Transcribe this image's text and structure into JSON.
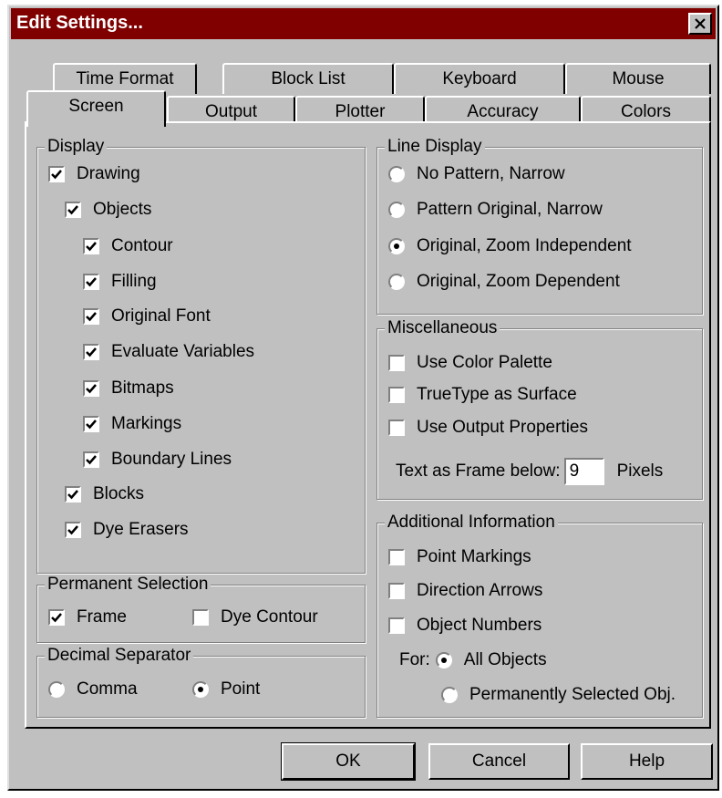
{
  "window": {
    "title": "Edit Settings..."
  },
  "tabs_back": [
    {
      "label": "Time Format"
    },
    {
      "label": "Block List"
    },
    {
      "label": "Keyboard"
    },
    {
      "label": "Mouse"
    }
  ],
  "tabs_front": [
    {
      "label": "Screen",
      "active": true
    },
    {
      "label": "Output"
    },
    {
      "label": "Plotter"
    },
    {
      "label": "Accuracy"
    },
    {
      "label": "Colors"
    }
  ],
  "display": {
    "legend": "Display",
    "items": [
      {
        "label": "Drawing",
        "checked": true
      },
      {
        "label": "Objects",
        "checked": true
      },
      {
        "label": "Contour",
        "checked": true
      },
      {
        "label": "Filling",
        "checked": true
      },
      {
        "label": "Original Font",
        "checked": true
      },
      {
        "label": "Evaluate Variables",
        "checked": true
      },
      {
        "label": "Bitmaps",
        "checked": true
      },
      {
        "label": "Markings",
        "checked": true
      },
      {
        "label": "Boundary Lines",
        "checked": true
      },
      {
        "label": "Blocks",
        "checked": true
      },
      {
        "label": "Dye Erasers",
        "checked": true
      }
    ]
  },
  "permanent_selection": {
    "legend": "Permanent Selection",
    "frame": {
      "label": "Frame",
      "checked": true
    },
    "dye_contour": {
      "label": "Dye Contour",
      "checked": false
    }
  },
  "decimal_separator": {
    "legend": "Decimal Separator",
    "comma": {
      "label": "Comma",
      "selected": false
    },
    "point": {
      "label": "Point",
      "selected": true
    }
  },
  "line_display": {
    "legend": "Line Display",
    "options": [
      {
        "label": "No Pattern, Narrow",
        "selected": false
      },
      {
        "label": "Pattern Original, Narrow",
        "selected": false
      },
      {
        "label": "Original, Zoom Independent",
        "selected": true
      },
      {
        "label": "Original, Zoom Dependent",
        "selected": false
      }
    ]
  },
  "misc": {
    "legend": "Miscellaneous",
    "items": [
      {
        "label": "Use Color Palette",
        "checked": false
      },
      {
        "label": "TrueType as Surface",
        "checked": false
      },
      {
        "label": "Use Output Properties",
        "checked": false
      }
    ],
    "frame_label": "Text as Frame below:",
    "frame_value": "9",
    "frame_unit": "Pixels"
  },
  "additional": {
    "legend": "Additional Information",
    "items": [
      {
        "label": "Point Markings",
        "checked": false
      },
      {
        "label": "Direction Arrows",
        "checked": false
      },
      {
        "label": "Object Numbers",
        "checked": false
      }
    ],
    "for_label": "For:",
    "all_objects": {
      "label": "All Objects",
      "selected": true
    },
    "perm_selected": {
      "label": "Permanently Selected Obj.",
      "selected": false
    }
  },
  "buttons": {
    "ok": "OK",
    "cancel": "Cancel",
    "help": "Help"
  }
}
